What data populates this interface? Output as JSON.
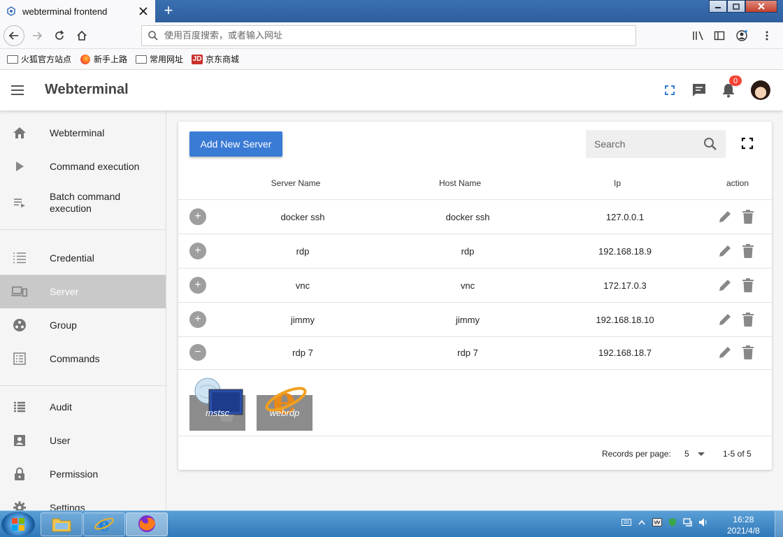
{
  "browser": {
    "tab_title": "webterminal frontend",
    "new_tab_label": "+",
    "url_placeholder": "使用百度搜索，或者输入网址",
    "bookmarks": [
      {
        "label": "火狐官方站点",
        "icon": "folder-icon"
      },
      {
        "label": "新手上路",
        "icon": "firefox-icon"
      },
      {
        "label": "常用网址",
        "icon": "folder-icon"
      },
      {
        "label": "京东商城",
        "icon": "jd-icon",
        "icon_text": "JD"
      }
    ]
  },
  "app": {
    "title": "Webterminal",
    "notification_count": "0"
  },
  "sidebar": {
    "items": [
      {
        "label": "Webterminal",
        "icon": "home-icon"
      },
      {
        "label": "Command execution",
        "icon": "play-icon"
      },
      {
        "label": "Batch command execution",
        "icon": "playlist-play-icon"
      },
      {
        "label": "Credential",
        "icon": "list-icon"
      },
      {
        "label": "Server",
        "icon": "devices-icon",
        "active": true
      },
      {
        "label": "Group",
        "icon": "group-icon"
      },
      {
        "label": "Commands",
        "icon": "commands-icon"
      },
      {
        "label": "Audit",
        "icon": "audit-list-icon"
      },
      {
        "label": "User",
        "icon": "user-icon"
      },
      {
        "label": "Permission",
        "icon": "lock-icon"
      },
      {
        "label": "Settings",
        "icon": "gear-icon"
      }
    ]
  },
  "main": {
    "add_button": "Add New Server",
    "search_placeholder": "Search",
    "columns": [
      "Server Name",
      "Host Name",
      "Ip",
      "action"
    ],
    "rows": [
      {
        "server_name": "docker ssh",
        "host_name": "docker ssh",
        "ip": "127.0.0.1",
        "expanded": false,
        "toggle": "+"
      },
      {
        "server_name": "rdp",
        "host_name": "rdp",
        "ip": "192.168.18.9",
        "expanded": false,
        "toggle": "+"
      },
      {
        "server_name": "vnc",
        "host_name": "vnc",
        "ip": "172.17.0.3",
        "expanded": false,
        "toggle": "+"
      },
      {
        "server_name": "jimmy",
        "host_name": "jimmy",
        "ip": "192.168.18.10",
        "expanded": false,
        "toggle": "+"
      },
      {
        "server_name": "rdp 7",
        "host_name": "rdp 7",
        "ip": "192.168.18.7",
        "expanded": true,
        "toggle": "−"
      }
    ],
    "launchers": [
      {
        "label": "mstsc",
        "icon": "remote-desktop-icon"
      },
      {
        "label": "webrdp",
        "icon": "internet-explorer-icon"
      }
    ],
    "footer": {
      "records_per_page_label": "Records per page:",
      "records_per_page_value": "5",
      "page_info": "1-5 of 5"
    }
  },
  "taskbar": {
    "time": "16:28",
    "date": "2021/4/8"
  },
  "colors": {
    "primary": "#3a7bd5",
    "active_nav": "#c9c9c9",
    "badge": "#f44336",
    "taskbar": "#2f78b8"
  }
}
